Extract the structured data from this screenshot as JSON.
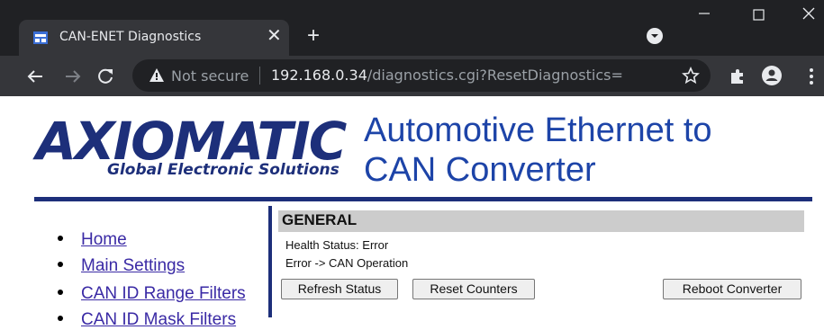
{
  "browser": {
    "tab_title": "CAN-ENET Diagnostics",
    "new_tab_icon": "plus-icon",
    "omnibox": {
      "security_label": "Not secure",
      "url_host": "192.168.0.34",
      "url_path": "/diagnostics.cgi?ResetDiagnostics="
    }
  },
  "header": {
    "logo_text": "AXIOMATIC",
    "logo_tagline": "Global Electronic Solutions",
    "title_line1": "Automotive Ethernet to",
    "title_line2": "CAN Converter"
  },
  "nav": {
    "items": [
      {
        "label": "Home"
      },
      {
        "label": "Main Settings"
      },
      {
        "label": "CAN ID Range Filters"
      },
      {
        "label": "CAN ID Mask Filters"
      }
    ]
  },
  "general": {
    "title": "GENERAL",
    "health_status": "Health Status: Error",
    "error_detail": "Error -> CAN Operation",
    "buttons": {
      "refresh": "Refresh Status",
      "reset": "Reset Counters",
      "reboot": "Reboot Converter"
    }
  },
  "colors": {
    "brand_navy": "#1d2f7a",
    "heading_blue": "#1d44a8",
    "link_purple": "#3a2aa5"
  }
}
